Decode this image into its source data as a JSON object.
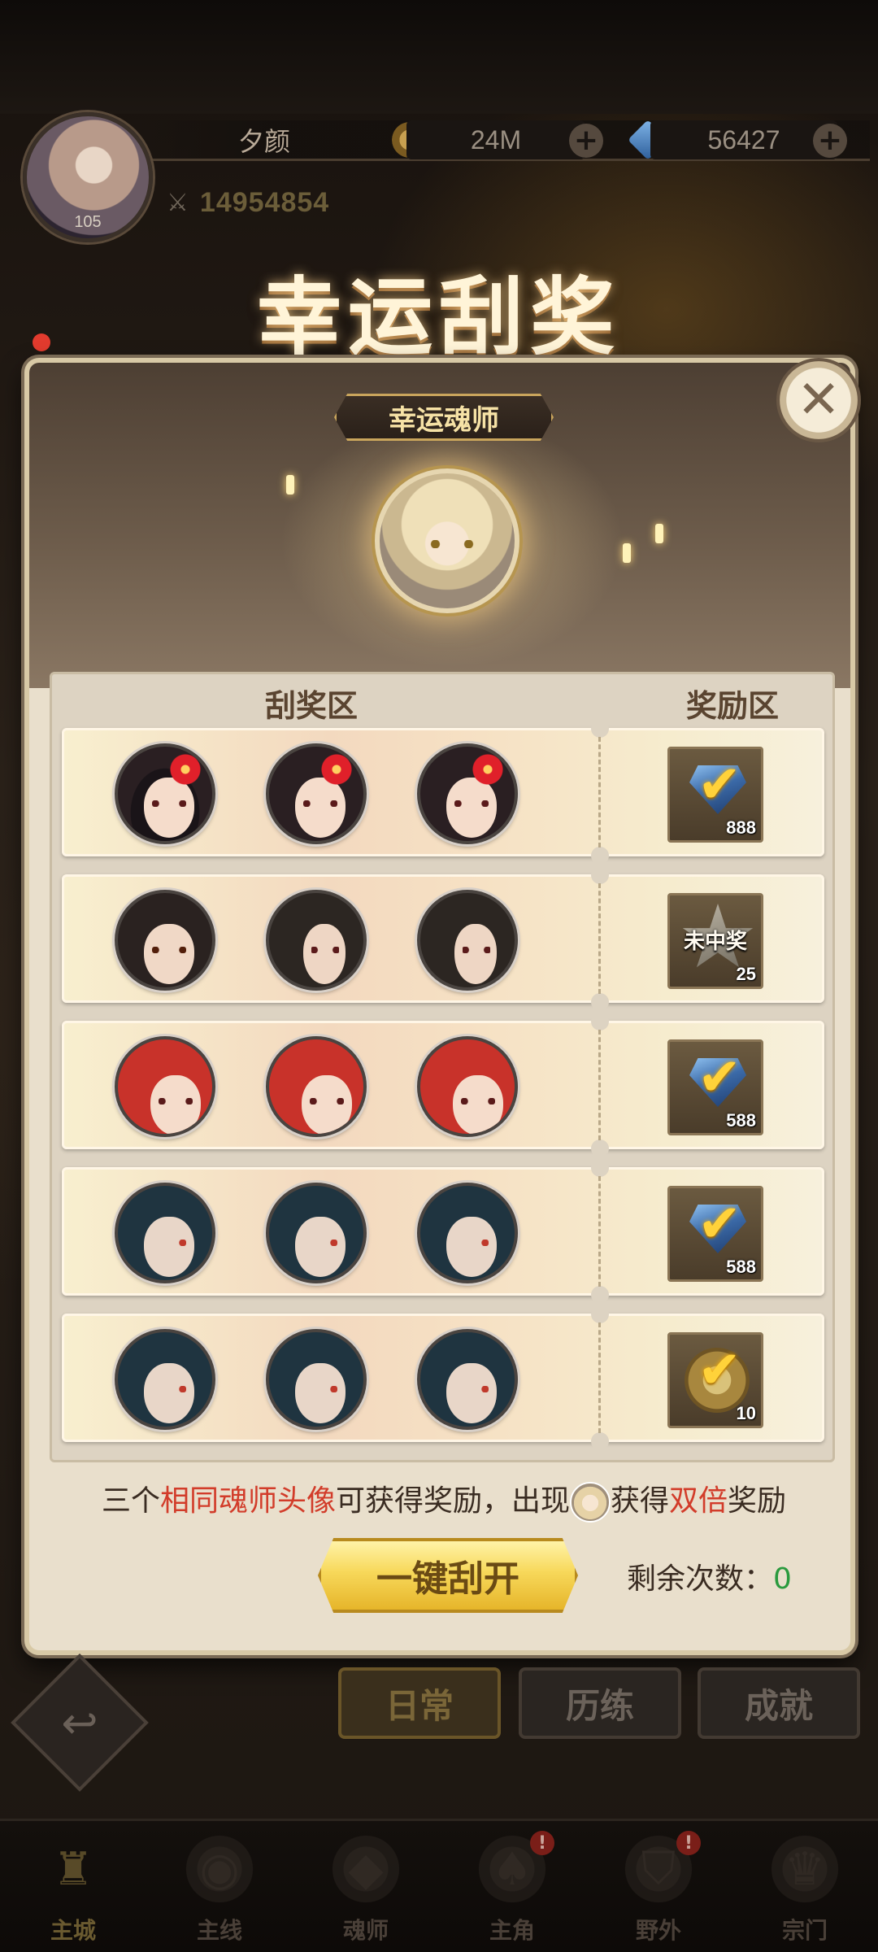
{
  "player": {
    "name": "夕颜",
    "level": "105",
    "power": "14954854",
    "gold": "24M",
    "diamonds": "56427"
  },
  "event": {
    "title": "幸运刮奖",
    "featured_label": "幸运魂师"
  },
  "board": {
    "scratch_header": "刮奖区",
    "reward_header": "奖励区",
    "tickets": [
      {
        "portraits": [
          "red-flower-hair-girl",
          "red-flower-hair-girl",
          "red-flower-hair-girl"
        ],
        "reward": {
          "icon": "diamond-icon",
          "matched": true,
          "label": "",
          "qty": "888"
        }
      },
      {
        "portraits": [
          "dark-hair-man",
          "dark-hair-man-side",
          "dark-hair-man-side"
        ],
        "reward": {
          "icon": "star-icon",
          "matched": false,
          "label": "未中奖",
          "qty": "25"
        }
      },
      {
        "portraits": [
          "red-hair-man",
          "red-hair-man",
          "red-hair-man"
        ],
        "reward": {
          "icon": "diamond-icon",
          "matched": true,
          "label": "",
          "qty": "588"
        }
      },
      {
        "portraits": [
          "blue-hair-masked-man",
          "blue-hair-masked-man",
          "blue-hair-masked-man"
        ],
        "reward": {
          "icon": "diamond-icon",
          "matched": true,
          "label": "",
          "qty": "588"
        }
      },
      {
        "portraits": [
          "blue-hair-masked-man",
          "blue-hair-masked-man",
          "blue-hair-masked-man"
        ],
        "reward": {
          "icon": "coin-icon",
          "matched": true,
          "label": "",
          "qty": "10"
        }
      }
    ]
  },
  "rules": {
    "part1": "三个",
    "part2": "相同魂师头像",
    "part3": "可获得奖励，出现",
    "part4": "获得",
    "part5": "双倍",
    "part6": "奖励"
  },
  "actions": {
    "scratch_all": "一键刮开",
    "remaining_label": "剩余次数：",
    "remaining_count": "0"
  },
  "tabs": [
    "日常",
    "历练",
    "成就"
  ],
  "nav": [
    {
      "label": "主城",
      "icon": "castle-icon",
      "badge": ""
    },
    {
      "label": "主线",
      "icon": "mainline-icon",
      "badge": ""
    },
    {
      "label": "魂师",
      "icon": "soulmaster-icon",
      "badge": ""
    },
    {
      "label": "主角",
      "icon": "hero-icon",
      "badge": "!"
    },
    {
      "label": "野外",
      "icon": "wild-icon",
      "badge": "!"
    },
    {
      "label": "宗门",
      "icon": "sect-icon",
      "badge": ""
    }
  ],
  "colors": {
    "accent_red": "#d23c2a",
    "count_green": "#2a9a3e",
    "gold": "#f7d85a"
  }
}
